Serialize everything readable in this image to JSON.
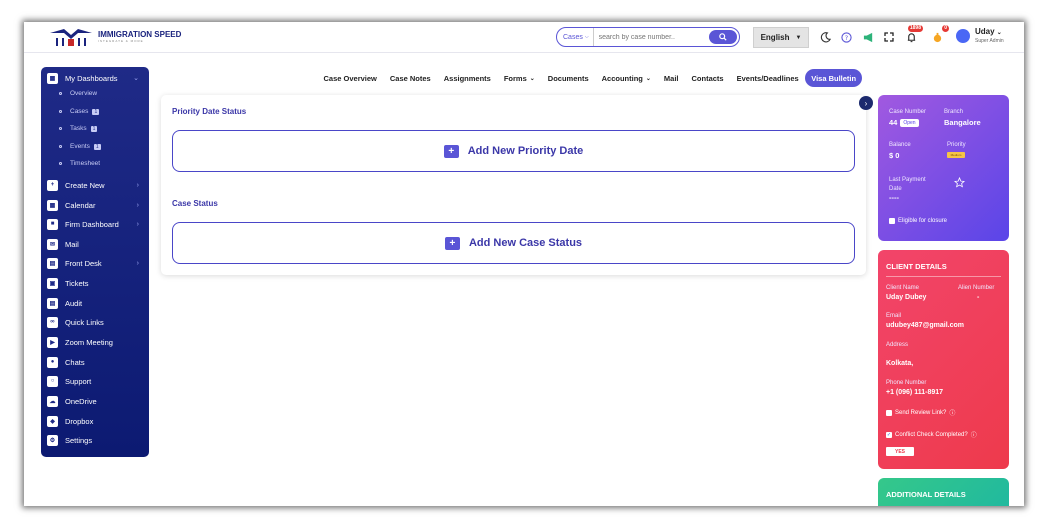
{
  "brand": {
    "name": "IMMIGRATION SPEED",
    "tagline": "INTEGRATE & MORE"
  },
  "search": {
    "scope": "Cases",
    "placeholder": "search by case number.."
  },
  "language": "English",
  "notifications": {
    "bell_count": "1898",
    "alert_count": "0"
  },
  "user": {
    "name": "Uday",
    "role": "Super Admin"
  },
  "sidebar": {
    "header": "My Dashboards",
    "subitems": [
      {
        "label": "Overview",
        "count": ""
      },
      {
        "label": "Cases",
        "count": "1"
      },
      {
        "label": "Tasks",
        "count": "1"
      },
      {
        "label": "Events",
        "count": "1"
      },
      {
        "label": "Timesheet",
        "count": ""
      }
    ],
    "items": [
      {
        "label": "Create New",
        "icon": "plus-square-icon",
        "chevron": true
      },
      {
        "label": "Calendar",
        "icon": "calendar-icon",
        "chevron": true
      },
      {
        "label": "Firm Dashboard",
        "icon": "lock-icon",
        "chevron": true
      },
      {
        "label": "Mail",
        "icon": "mail-icon",
        "chevron": false
      },
      {
        "label": "Front Desk",
        "icon": "clipboard-icon",
        "chevron": true
      },
      {
        "label": "Tickets",
        "icon": "ticket-icon",
        "chevron": false
      },
      {
        "label": "Audit",
        "icon": "audit-icon",
        "chevron": false
      },
      {
        "label": "Quick Links",
        "icon": "link-icon",
        "chevron": false
      },
      {
        "label": "Zoom Meeting",
        "icon": "video-icon",
        "chevron": false
      },
      {
        "label": "Chats",
        "icon": "chat-icon",
        "chevron": false
      },
      {
        "label": "Support",
        "icon": "headset-icon",
        "chevron": false
      },
      {
        "label": "OneDrive",
        "icon": "cloud-icon",
        "chevron": false
      },
      {
        "label": "Dropbox",
        "icon": "dropbox-icon",
        "chevron": false
      },
      {
        "label": "Settings",
        "icon": "gear-icon",
        "chevron": false
      }
    ]
  },
  "tabs": [
    {
      "label": "Case Overview",
      "dropdown": false,
      "active": false
    },
    {
      "label": "Case Notes",
      "dropdown": false,
      "active": false
    },
    {
      "label": "Assignments",
      "dropdown": false,
      "active": false
    },
    {
      "label": "Forms",
      "dropdown": true,
      "active": false
    },
    {
      "label": "Documents",
      "dropdown": false,
      "active": false
    },
    {
      "label": "Accounting",
      "dropdown": true,
      "active": false
    },
    {
      "label": "Mail",
      "dropdown": false,
      "active": false
    },
    {
      "label": "Contacts",
      "dropdown": false,
      "active": false
    },
    {
      "label": "Events/Deadlines",
      "dropdown": false,
      "active": false
    },
    {
      "label": "Visa Bulletin",
      "dropdown": false,
      "active": true
    }
  ],
  "main": {
    "priority_title": "Priority Date Status",
    "priority_add": "Add New Priority Date",
    "case_title": "Case Status",
    "case_add": "Add New Case Status"
  },
  "case_card": {
    "case_number_label": "Case Number",
    "case_number": "44",
    "case_status": "Open",
    "branch_label": "Branch",
    "branch": "Bangalore",
    "balance_label": "Balance",
    "balance": "$ 0",
    "priority_label": "Priority",
    "priority": "Medium",
    "last_payment_label": "Last Payment Date",
    "last_payment": "----",
    "eligible_label": "Eligible for closure"
  },
  "client": {
    "title": "CLIENT DETAILS",
    "name_label": "Client Name",
    "name": "Uday Dubey",
    "alien_label": "Alien Number",
    "alien": "-",
    "email_label": "Email",
    "email": "udubey487@gmail.com",
    "address_label": "Address",
    "address": "Kolkata,",
    "phone_label": "Phone Number",
    "phone": "+1 (096) 111-8917",
    "review_label": "Send Review Link?",
    "conflict_label": "Conflict Check Completed?",
    "conflict_value": "YES"
  },
  "additional": {
    "title": "ADDITIONAL DETAILS"
  },
  "colors": {
    "accent": "#5a55d6",
    "sidebar": "#1f2a87",
    "case_card": "#7a4ee6",
    "client_card": "#ee3a4c",
    "additional": "#2cc28f"
  }
}
